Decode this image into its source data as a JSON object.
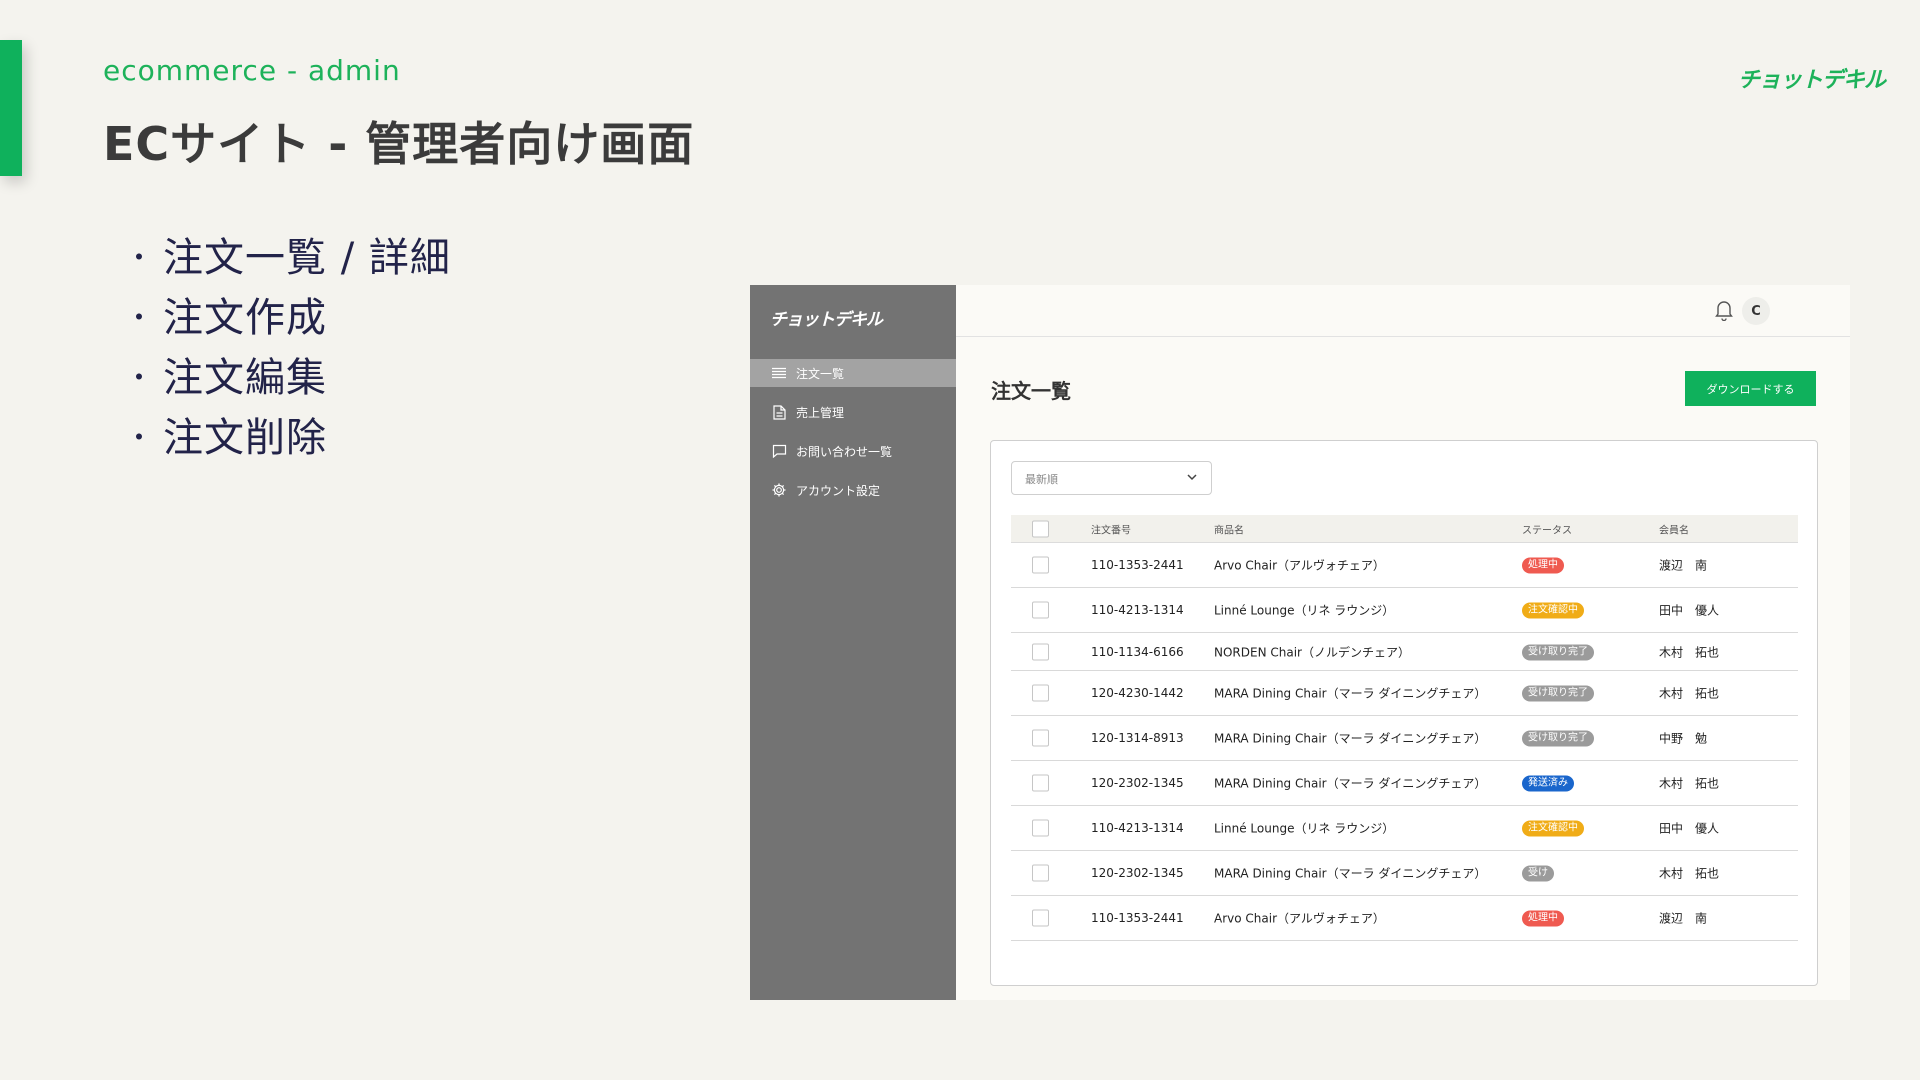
{
  "slide": {
    "subtitle": "ecommerce - admin",
    "title": "ECサイト - 管理者向け画面",
    "brand": "チョットデキル",
    "accent_color": "#0fb15c",
    "bullets": [
      "注文一覧 / 詳細",
      "注文作成",
      "注文編集",
      "注文削除"
    ]
  },
  "app": {
    "logo": "チョットデキル",
    "nav": [
      {
        "label": "注文一覧",
        "icon": "list-icon",
        "active": true
      },
      {
        "label": "売上管理",
        "icon": "document-icon",
        "active": false
      },
      {
        "label": "お問い合わせ一覧",
        "icon": "chat-icon",
        "active": false
      },
      {
        "label": "アカウント設定",
        "icon": "gear-icon",
        "active": false
      }
    ],
    "topbar": {
      "avatar_initial": "C"
    },
    "page_title": "注文一覧",
    "download_label": "ダウンロードする",
    "sort": {
      "value": "最新順"
    },
    "table": {
      "headers": {
        "order_no": "注文番号",
        "product": "商品名",
        "status": "ステータス",
        "member": "会員名"
      },
      "rows": [
        {
          "order_no": "110-1353-2441",
          "product": "Arvo Chair（アルヴォチェア）",
          "status": "処理中",
          "status_color": "#ef5a50",
          "member": "渡辺　南"
        },
        {
          "order_no": "110-4213-1314",
          "product": "Linné Lounge（リネ ラウンジ）",
          "status": "注文確認中",
          "status_color": "#f0ac17",
          "member": "田中　優人"
        },
        {
          "order_no": "110-1134-6166",
          "product": "NORDEN Chair（ノルデンチェア）",
          "status": "受け取り完了",
          "status_color": "#9b9b9b",
          "member": "木村　拓也"
        },
        {
          "order_no": "120-4230-1442",
          "product": "MARA Dining Chair（マーラ ダイニングチェア）",
          "status": "受け取り完了",
          "status_color": "#9b9b9b",
          "member": "木村　拓也"
        },
        {
          "order_no": "120-1314-8913",
          "product": "MARA Dining Chair（マーラ ダイニングチェア）",
          "status": "受け取り完了",
          "status_color": "#9b9b9b",
          "member": "中野　勉"
        },
        {
          "order_no": "120-2302-1345",
          "product": "MARA Dining Chair（マーラ ダイニングチェア）",
          "status": "発送済み",
          "status_color": "#1a66cc",
          "member": "木村　拓也"
        },
        {
          "order_no": "110-4213-1314",
          "product": "Linné Lounge（リネ ラウンジ）",
          "status": "注文確認中",
          "status_color": "#f0ac17",
          "member": "田中　優人"
        },
        {
          "order_no": "120-2302-1345",
          "product": "MARA Dining Chair（マーラ ダイニングチェア）",
          "status": "受け",
          "status_color": "#9b9b9b",
          "member": "木村　拓也"
        },
        {
          "order_no": "110-1353-2441",
          "product": "Arvo Chair（アルヴォチェア）",
          "status": "処理中",
          "status_color": "#ef5a50",
          "member": "渡辺　南"
        }
      ]
    }
  }
}
